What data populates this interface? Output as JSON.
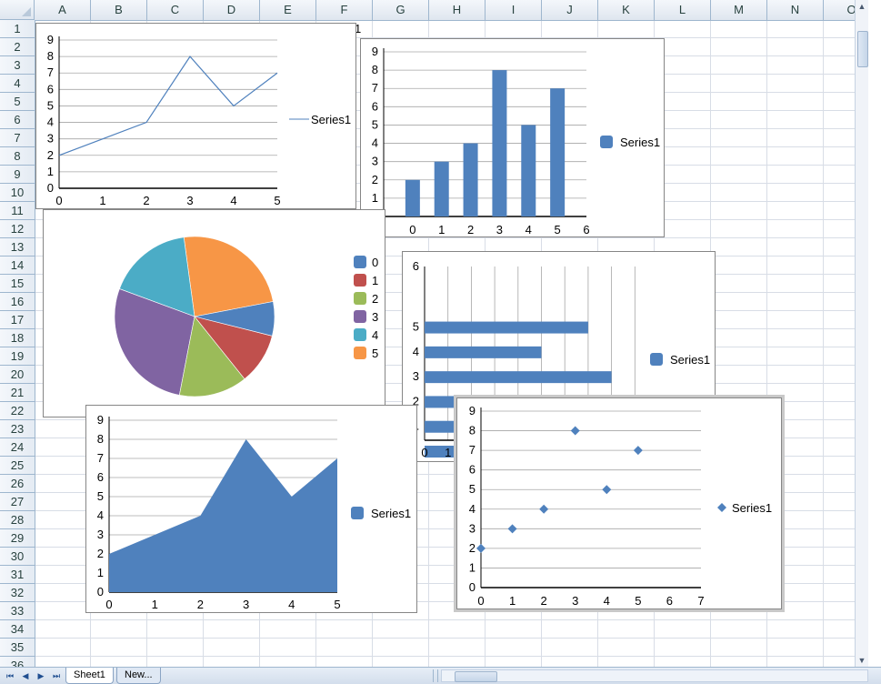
{
  "sheet": {
    "columns": [
      "A",
      "B",
      "C",
      "D",
      "E",
      "F",
      "G",
      "H",
      "I",
      "J",
      "K",
      "L",
      "M",
      "N",
      "O"
    ],
    "rows": [
      "1",
      "2",
      "3",
      "4",
      "5",
      "6",
      "7",
      "8",
      "9",
      "10",
      "11",
      "12",
      "13",
      "14",
      "15",
      "16",
      "17",
      "18",
      "19",
      "20",
      "21",
      "22",
      "23",
      "24",
      "25",
      "26",
      "27",
      "28",
      "29",
      "30",
      "31",
      "32",
      "33",
      "34",
      "35",
      "36"
    ],
    "partial_cell_text": "1"
  },
  "tabs": {
    "sheet1": "Sheet1",
    "new": "New..."
  },
  "nav_icons": [
    "first-sheet-icon",
    "prev-sheet-icon",
    "next-sheet-icon",
    "last-sheet-icon"
  ],
  "colors": {
    "series": "#4f81bd",
    "pie": [
      "#4f81bd",
      "#c0504d",
      "#9bbb59",
      "#8064a2",
      "#4bacc6",
      "#f79646"
    ]
  },
  "chart_data": [
    {
      "type": "line",
      "x": [
        0,
        1,
        2,
        3,
        4,
        5
      ],
      "values": [
        2,
        3,
        4,
        8,
        5,
        7
      ],
      "xticks": [
        "0",
        "1",
        "2",
        "3",
        "4",
        "5"
      ],
      "yticks": [
        "0",
        "1",
        "2",
        "3",
        "4",
        "5",
        "6",
        "7",
        "8",
        "9"
      ],
      "ylim": [
        0,
        9
      ],
      "series": [
        {
          "name": "Series1",
          "values": [
            2,
            3,
            4,
            8,
            5,
            7
          ]
        }
      ],
      "legend": "right"
    },
    {
      "type": "bar",
      "x": [
        0,
        1,
        2,
        3,
        4,
        5
      ],
      "values": [
        2,
        3,
        4,
        8,
        5,
        7
      ],
      "xticks": [
        "0",
        "1",
        "2",
        "3",
        "4",
        "5",
        "6"
      ],
      "yticks": [
        "1",
        "2",
        "3",
        "4",
        "5",
        "6",
        "7",
        "8",
        "9"
      ],
      "ylim": [
        0,
        9
      ],
      "xlim": [
        -1,
        6
      ],
      "series": [
        {
          "name": "Series1",
          "values": [
            2,
            3,
            4,
            8,
            5,
            7
          ]
        }
      ],
      "legend": "right"
    },
    {
      "type": "pie",
      "categories": [
        "0",
        "1",
        "2",
        "3",
        "4",
        "5"
      ],
      "values": [
        2,
        3,
        4,
        8,
        5,
        7
      ],
      "legend": "right"
    },
    {
      "type": "bar",
      "orientation": "horizontal",
      "categories": [
        "0",
        "1",
        "2",
        "3",
        "4",
        "5"
      ],
      "values": [
        2,
        3,
        4,
        8,
        5,
        7
      ],
      "yticks": [
        "1",
        "2",
        "3",
        "4",
        "5",
        "6"
      ],
      "xticks_visible": [
        "0",
        "1"
      ],
      "series": [
        {
          "name": "Series1",
          "values": [
            2,
            3,
            4,
            8,
            5,
            7
          ]
        }
      ],
      "legend": "right"
    },
    {
      "type": "area",
      "x": [
        0,
        1,
        2,
        3,
        4,
        5
      ],
      "values": [
        2,
        3,
        4,
        8,
        5,
        7
      ],
      "xticks": [
        "0",
        "1",
        "2",
        "3",
        "4",
        "5"
      ],
      "yticks": [
        "0",
        "1",
        "2",
        "3",
        "4",
        "5",
        "6",
        "7",
        "8",
        "9"
      ],
      "ylim": [
        0,
        9
      ],
      "series": [
        {
          "name": "Series1",
          "values": [
            2,
            3,
            4,
            8,
            5,
            7
          ]
        }
      ],
      "legend": "right"
    },
    {
      "type": "scatter",
      "x": [
        0,
        1,
        2,
        3,
        4,
        5
      ],
      "values": [
        2,
        3,
        4,
        8,
        5,
        7
      ],
      "xticks": [
        "0",
        "1",
        "2",
        "3",
        "4",
        "5",
        "6",
        "7"
      ],
      "yticks": [
        "0",
        "1",
        "2",
        "3",
        "4",
        "5",
        "6",
        "7",
        "8",
        "9"
      ],
      "xlim": [
        0,
        7
      ],
      "ylim": [
        0,
        9
      ],
      "series": [
        {
          "name": "Series1",
          "values": [
            2,
            3,
            4,
            8,
            5,
            7
          ]
        }
      ],
      "legend": "right"
    }
  ]
}
